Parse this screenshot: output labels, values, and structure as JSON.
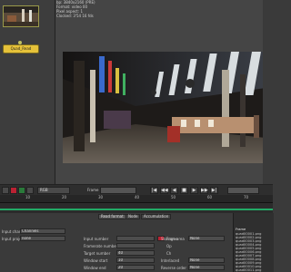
{
  "node_graph": {
    "node_label": "Quad_Read"
  },
  "viewer": {
    "info": [
      "bp: 3840x2160 (PRE)",
      "Format: video 00",
      "Pixel aspect: 1",
      "Clocked: 3'54 16 fds"
    ]
  },
  "toolbar": {
    "view_dropdown": "RGB",
    "frame_label": "Frame",
    "transport_glyphs": [
      "|◀",
      "◀◀",
      "◀",
      "■",
      "▶",
      "▶▶",
      "▶|"
    ]
  },
  "timeline": {
    "ticks": [
      "10",
      "20",
      "30",
      "40",
      "50",
      "60",
      "70"
    ]
  },
  "properties": {
    "tabs": [
      "Read format",
      "Node",
      "Accumulation"
    ],
    "left_labels": [
      "Input channel",
      "Input project",
      "Input number",
      "Framerate number",
      "Target number",
      "Window start",
      "Window end"
    ],
    "left_values": [
      "Channels",
      "none",
      "",
      "",
      "40",
      "10",
      "20"
    ],
    "right_labels": [
      "Interlaced",
      "Reverse order",
      "Storage area"
    ],
    "right_values": [
      "None",
      "None",
      "None"
    ],
    "mid_labels": [
      "Frame",
      "Op",
      "Ch"
    ]
  },
  "list": {
    "header": "Frame",
    "rows": [
      "quad00001.png",
      "quad00002.png",
      "quad00003.png",
      "quad00004.png",
      "quad00005.png",
      "quad00006.png",
      "quad00007.png",
      "quad00008.png",
      "quad00009.png",
      "quad00010.png",
      "quad00011.png",
      "quad00012.png",
      "quad00013.png"
    ]
  }
}
